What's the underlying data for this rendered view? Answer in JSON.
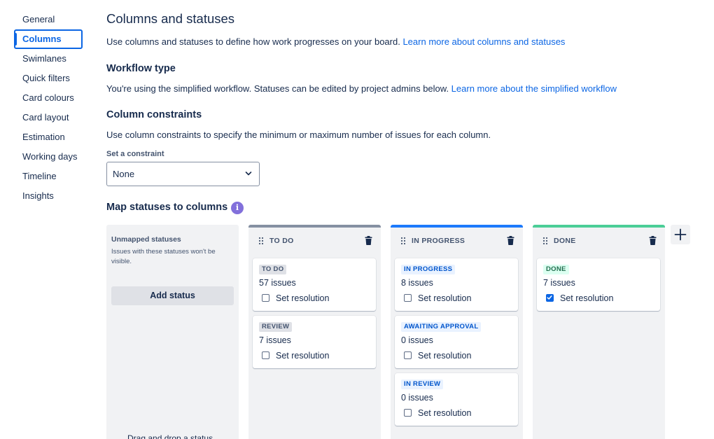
{
  "sidebar": {
    "items": [
      {
        "label": "General",
        "active": false
      },
      {
        "label": "Columns",
        "active": true
      },
      {
        "label": "Swimlanes",
        "active": false
      },
      {
        "label": "Quick filters",
        "active": false
      },
      {
        "label": "Card colours",
        "active": false
      },
      {
        "label": "Card layout",
        "active": false
      },
      {
        "label": "Estimation",
        "active": false
      },
      {
        "label": "Working days",
        "active": false
      },
      {
        "label": "Timeline",
        "active": false
      },
      {
        "label": "Insights",
        "active": false
      }
    ]
  },
  "main": {
    "title": "Columns and statuses",
    "intro_text": "Use columns and statuses to define how work progresses on your board. ",
    "intro_link": "Learn more about columns and statuses",
    "workflow_heading": "Workflow type",
    "workflow_text": "You're using the simplified workflow. Statuses can be edited by project admins below. ",
    "workflow_link": "Learn more about the simplified workflow",
    "constraints_heading": "Column constraints",
    "constraints_text": "Use column constraints to specify the minimum or maximum number of issues for each column.",
    "constraint_label": "Set a constraint",
    "constraint_value": "None",
    "map_heading": "Map statuses to columns",
    "info_glyph": "i"
  },
  "board": {
    "unmapped": {
      "title": "Unmapped statuses",
      "description": "Issues with these statuses won't be visible.",
      "add_status": "Add status",
      "drag_hint": "Drag and drop a status"
    },
    "columns": [
      {
        "title": "TO DO",
        "bar_color": "#8590a2",
        "statuses": [
          {
            "name": "TO DO",
            "count": "57",
            "unit": " issues",
            "resolution": "Set resolution",
            "checked": false,
            "tone": "grey"
          },
          {
            "name": "REVIEW",
            "count": "7",
            "unit": " issues",
            "resolution": "Set resolution",
            "checked": false,
            "tone": "grey"
          }
        ]
      },
      {
        "title": "IN PROGRESS",
        "bar_color": "#1d7afc",
        "statuses": [
          {
            "name": "IN PROGRESS",
            "count": "8",
            "unit": " issues",
            "resolution": "Set resolution",
            "checked": false,
            "tone": "blue"
          },
          {
            "name": "AWAITING APPROVAL",
            "count": "0",
            "unit": " issues",
            "resolution": "Set resolution",
            "checked": false,
            "tone": "blue"
          },
          {
            "name": "IN REVIEW",
            "count": "0",
            "unit": " issues",
            "resolution": "Set resolution",
            "checked": false,
            "tone": "blue"
          }
        ]
      },
      {
        "title": "DONE",
        "bar_color": "#4bce97",
        "statuses": [
          {
            "name": "DONE",
            "count": "7",
            "unit": " issues",
            "resolution": "Set resolution",
            "checked": true,
            "tone": "green"
          }
        ]
      }
    ],
    "add_column_icon": "plus-icon"
  },
  "colors": {
    "accent": "#0c66e4",
    "text": "#172b4d",
    "column_bg": "#f1f2f4"
  }
}
